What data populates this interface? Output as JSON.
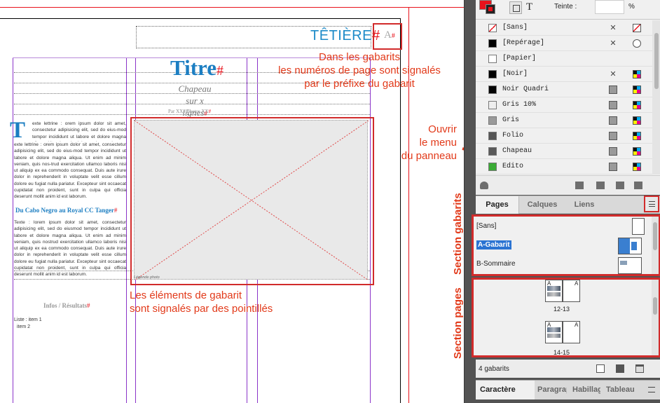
{
  "document": {
    "tetiere": "TÊTIÈRE",
    "hash": "#",
    "master_prefix": "A",
    "titre": "Titre",
    "chapeau": "Chapeau sur x lignes",
    "credit": "Par XX / Photos XX",
    "dropcap": "T",
    "body_text_1": "exte lettrine : orem ipsum dolor sit amet, consectetur adipisicing elit, sed do eius-mod tempor incididunt ut labore et dolore magna aliqua. Ut enim ad minim veniam, quis nos-trud exercitation ullamco laboris nisi ut aliquip ex ea commodo consequat. Duis aute irure dolor in reprehenderit in voluptate velit esse cillum dolore eu fugiat nulla pariatur. Excepteur sint occaecat cupidatat non proident, sunt in culpa qui officia deserunt mollit anim id est laborum.",
    "intertitre": "Du Cabo Negro au Royal CC Tanger",
    "body_text_2": "Texte : lorem ipsum dolor sit amet, consectetur adipisicing elit, sed do eiusmod tempor incididunt ut labore et dolore magna aliqua. Ut enim ad minim veniam, quis nostrud exercitation ullamco laboris nisi ut aliquip ex ea commodo consequat. Duis aute irure dolor in reprehenderit in voluptate velit esse cillum dolore eu fugiat nulla pariatur. Excepteur sint occaecat cupidatat non proident, sunt in culpa qui officia deserunt mollit anim id est laborum.",
    "infos": "Infos / Résultats",
    "liste_line1": "Liste : item 1",
    "liste_line2": "item 2",
    "legende": "Légende photo"
  },
  "annotations": {
    "gabarit_line1": "Dans les gabarits",
    "gabarit_line2": "les numéros de page sont signalés",
    "gabarit_line3": "par le préfixe du gabarit",
    "ouvrir_line1": "Ouvrir",
    "ouvrir_line2": "le menu",
    "ouvrir_line3": "du panneau",
    "elements_line1": "Les éléments de gabarit",
    "elements_line2": "sont signalés par des pointillés",
    "section_gabarits": "Section gabarits",
    "section_pages": "Section pages"
  },
  "swatches_panel": {
    "tint_label": "Teinte :",
    "tint_unit": "%",
    "swatches": [
      {
        "name": "[Sans]",
        "color": "none",
        "icon1": "lock-icon",
        "icon2": "none-icon"
      },
      {
        "name": "[Repérage]",
        "color": "#000000",
        "icon1": "lock-icon",
        "icon2": "registration-icon"
      },
      {
        "name": "[Papier]",
        "color": "#ffffff",
        "icon1": "",
        "icon2": ""
      },
      {
        "name": "[Noir]",
        "color": "#000000",
        "icon1": "lock-icon",
        "icon2": "cmyk-icon"
      },
      {
        "name": "Noir Quadri",
        "color": "#050505",
        "icon1": "process-icon",
        "icon2": "cmyk-icon"
      },
      {
        "name": "Gris 10%",
        "color": "#eeeeee",
        "icon1": "process-icon",
        "icon2": "cmyk-icon"
      },
      {
        "name": "Gris",
        "color": "#9a9a9a",
        "icon1": "process-icon",
        "icon2": "cmyk-icon"
      },
      {
        "name": "Folio",
        "color": "#555555",
        "icon1": "process-icon",
        "icon2": "cmyk-icon"
      },
      {
        "name": "Chapeau",
        "color": "#5a5a5a",
        "icon1": "process-icon",
        "icon2": "cmyk-icon"
      },
      {
        "name": "Edito",
        "color": "#3aab35",
        "icon1": "process-icon",
        "icon2": "cmyk-icon"
      }
    ]
  },
  "pages_panel": {
    "tabs": [
      "Pages",
      "Calques",
      "Liens"
    ],
    "masters": [
      "[Sans]",
      "A-Gabarit",
      "B-Sommaire"
    ],
    "spreads": [
      {
        "label": "12-13",
        "left_prefix": "A",
        "right_prefix": "A"
      },
      {
        "label": "14-15",
        "left_prefix": "A",
        "right_prefix": "A"
      }
    ],
    "footer_text": "4 gabarits"
  },
  "bottom_tabs": [
    "Caractère",
    "Paragraphe",
    "Habillage",
    "Tableau"
  ],
  "colors": {
    "accent": "#e23a1a",
    "blue": "#1c7ec2",
    "guide": "#8b34c9"
  }
}
